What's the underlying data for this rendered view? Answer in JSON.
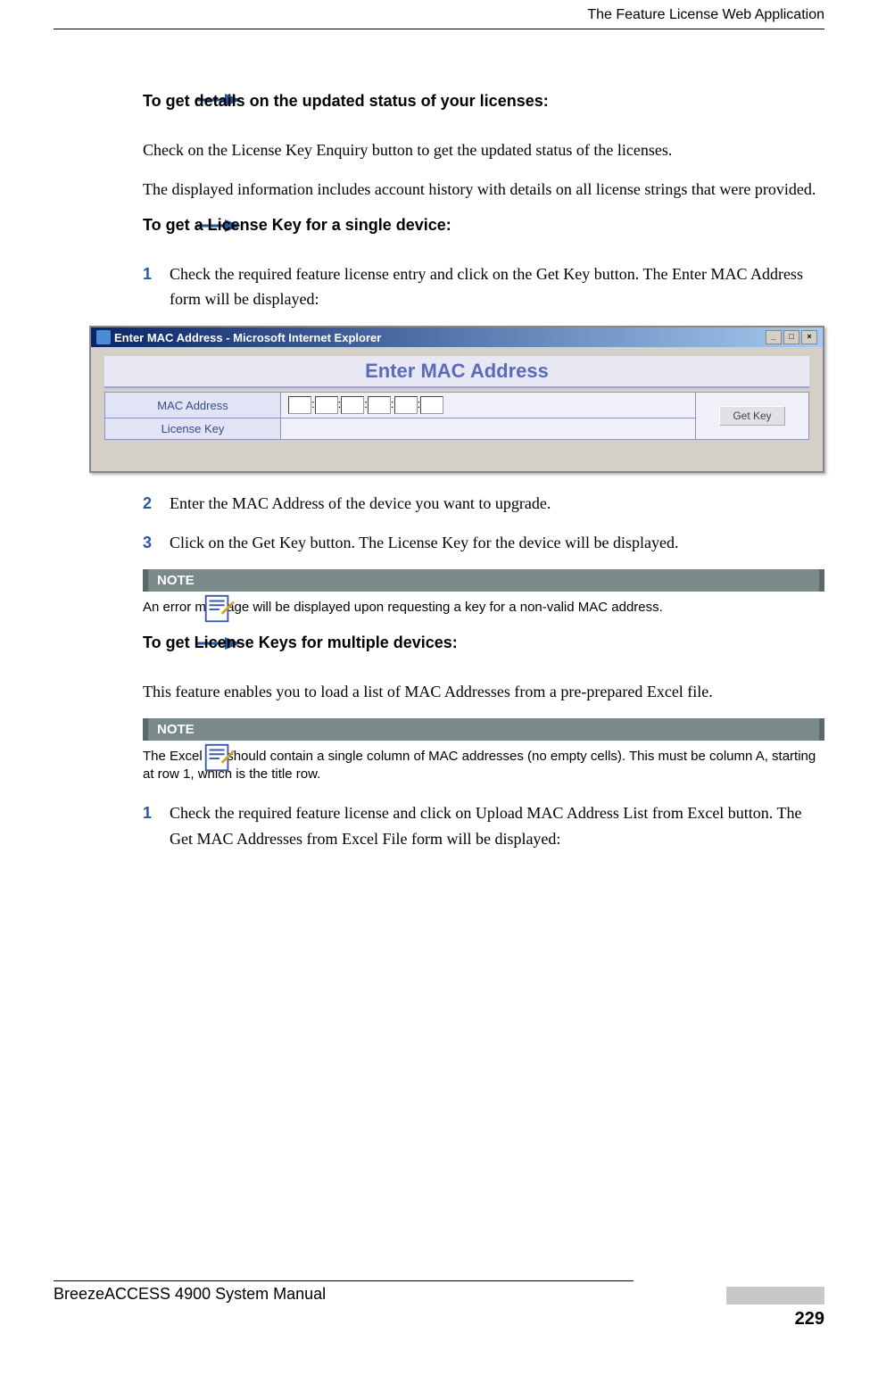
{
  "header": {
    "title": "The Feature License Web Application"
  },
  "sections": {
    "s1": {
      "heading": "To get details on the updated status of your licenses:",
      "p1": "Check on the License Key Enquiry button to get the updated status of the licenses.",
      "p2": "The displayed information includes account history with details on all license strings that were provided."
    },
    "s2": {
      "heading": "To get a License Key for a single device:",
      "step1_num": "1",
      "step1": "Check the required feature license entry and click on the Get Key button. The Enter MAC Address form will be displayed:",
      "step2_num": "2",
      "step2": "Enter the MAC Address of the device you want to upgrade.",
      "step3_num": "3",
      "step3": "Click on the Get Key button. The License Key for the device will be displayed."
    },
    "dialog": {
      "window_title": "Enter MAC Address - Microsoft Internet Explorer",
      "title": "Enter MAC Address",
      "row1_label": "MAC Address",
      "row2_label": "License Key",
      "button": "Get Key",
      "separator": ":"
    },
    "note1": {
      "label": "NOTE",
      "text": "An error message will be displayed upon requesting a key for a non-valid MAC address."
    },
    "s3": {
      "heading": "To get License Keys for multiple devices:",
      "p1": "This feature enables you to load a list of MAC Addresses from a pre-prepared Excel file."
    },
    "note2": {
      "label": "NOTE",
      "text": "The Excel file should contain a single column of MAC addresses (no empty cells). This must be column A, starting at row 1, which is the title row."
    },
    "s4": {
      "step1_num": "1",
      "step1": "Check the required feature license and click on Upload MAC Address List from Excel button. The Get MAC Addresses from Excel File form will be displayed:"
    }
  },
  "footer": {
    "manual_title": "BreezeACCESS 4900 System Manual",
    "page_number": "229"
  }
}
